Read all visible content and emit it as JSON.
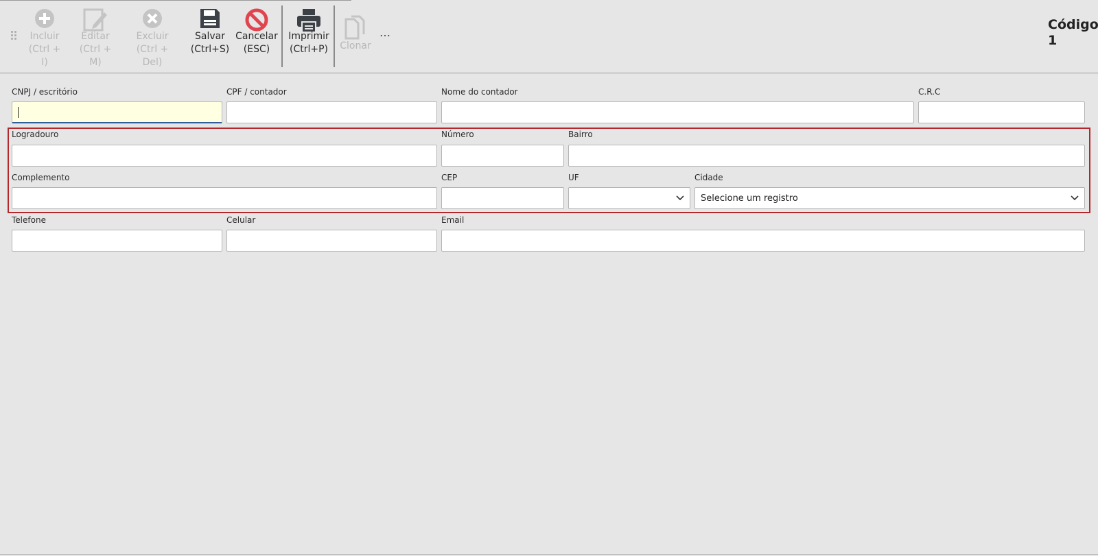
{
  "toolbar": {
    "buttons": [
      {
        "id": "incluir",
        "label": "Incluir",
        "shortcut": "(Ctrl + I)",
        "icon": "plus-circle-icon",
        "enabled": false
      },
      {
        "id": "editar",
        "label": "Editar",
        "shortcut": "(Ctrl + M)",
        "icon": "edit-icon",
        "enabled": false
      },
      {
        "id": "excluir",
        "label": "Excluir",
        "shortcut": "(Ctrl + Del)",
        "icon": "x-circle-icon",
        "enabled": false
      },
      {
        "id": "salvar",
        "label": "Salvar",
        "shortcut": "(Ctrl+S)",
        "icon": "save-icon",
        "enabled": true
      },
      {
        "id": "cancelar",
        "label": "Cancelar",
        "shortcut": "(ESC)",
        "icon": "cancel-icon",
        "enabled": true
      },
      {
        "id": "imprimir",
        "label": "Imprimir",
        "shortcut": "(Ctrl+P)",
        "icon": "printer-icon",
        "enabled": true
      },
      {
        "id": "clonar",
        "label": "Clonar",
        "shortcut": "",
        "icon": "copy-icon",
        "enabled": false
      }
    ],
    "more_label": "…",
    "codigo_label": "Código",
    "codigo_value": "1"
  },
  "form": {
    "cnpj": {
      "label": "CNPJ / escritório",
      "value": ""
    },
    "cpf": {
      "label": "CPF / contador",
      "value": ""
    },
    "nome": {
      "label": "Nome do contador",
      "value": ""
    },
    "crc": {
      "label": "C.R.C",
      "value": ""
    },
    "logradouro": {
      "label": "Logradouro",
      "value": ""
    },
    "numero": {
      "label": "Número",
      "value": ""
    },
    "bairro": {
      "label": "Bairro",
      "value": ""
    },
    "complemento": {
      "label": "Complemento",
      "value": ""
    },
    "cep": {
      "label": "CEP",
      "value": ""
    },
    "uf": {
      "label": "UF",
      "value": ""
    },
    "cidade": {
      "label": "Cidade",
      "value": "Selecione um registro"
    },
    "telefone": {
      "label": "Telefone",
      "value": ""
    },
    "celular": {
      "label": "Celular",
      "value": ""
    },
    "email": {
      "label": "Email",
      "value": ""
    }
  },
  "colors": {
    "background": "#e6e6e6",
    "highlight_border": "#b3282d",
    "cancel_icon": "#e0444f",
    "focus_field": "#ffffe2"
  }
}
